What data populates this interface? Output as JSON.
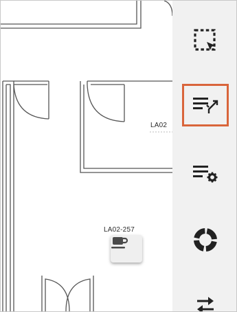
{
  "map": {
    "rooms": [
      {
        "label": "LA02"
      },
      {
        "label": "LA02-257"
      }
    ],
    "poi": {
      "icon": "coffee-cup-icon"
    }
  },
  "toolbar": {
    "accent_color": "#d9653b",
    "buttons": [
      {
        "icon": "select-region-icon",
        "tooltip": ""
      },
      {
        "icon": "list-route-icon",
        "selected": true
      },
      {
        "icon": "list-settings-icon"
      },
      {
        "icon": "ring-chart-icon"
      },
      {
        "icon": "swap-arrows-icon"
      }
    ]
  }
}
